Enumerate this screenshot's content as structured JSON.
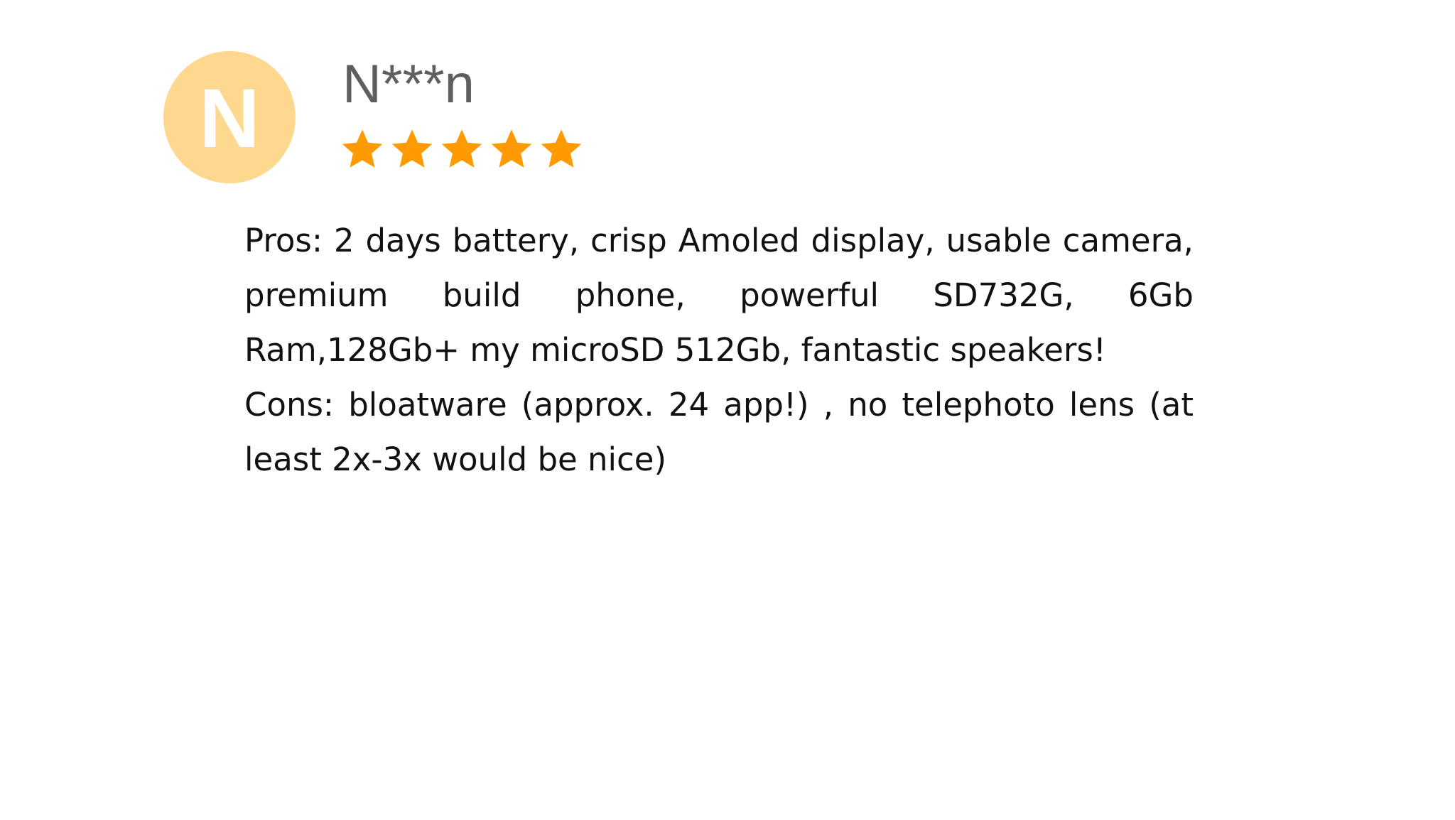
{
  "reviewer": {
    "initial": "N",
    "name": "N***n",
    "avatar_color": "#ffd88f"
  },
  "rating": {
    "value": 5,
    "max": 5,
    "star_color": "#ff9a00"
  },
  "review": {
    "pros": "Pros: 2 days battery, crisp Amoled display, usable camera, premium build phone, powerful SD732G, 6Gb Ram,128Gb+ my microSD 512Gb, fantastic speakers!",
    "cons": "Cons: bloatware (approx. 24 app!) , no telephoto lens (at least 2x-3x would be nice)"
  }
}
